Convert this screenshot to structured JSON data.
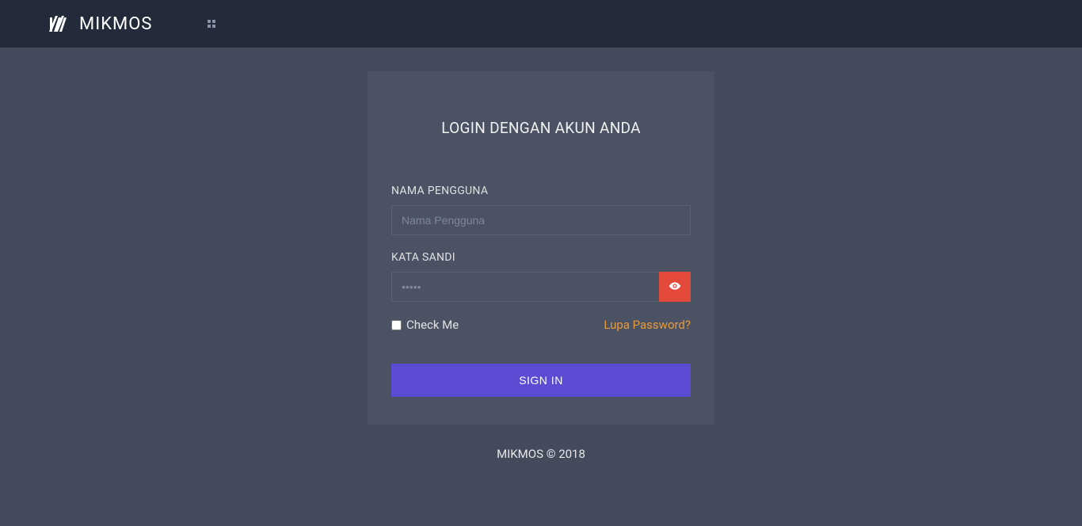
{
  "header": {
    "brand": "MIKMOS"
  },
  "login": {
    "title": "LOGIN DENGAN AKUN ANDA",
    "username_label": "NAMA PENGGUNA",
    "username_placeholder": "Nama Pengguna",
    "password_label": "KATA SANDI",
    "password_placeholder": "•••••",
    "checkbox_label": "Check Me",
    "forgot_label": "Lupa Password?",
    "submit_label": "SIGN IN"
  },
  "footer": {
    "text": "MIKMOS © 2018"
  }
}
